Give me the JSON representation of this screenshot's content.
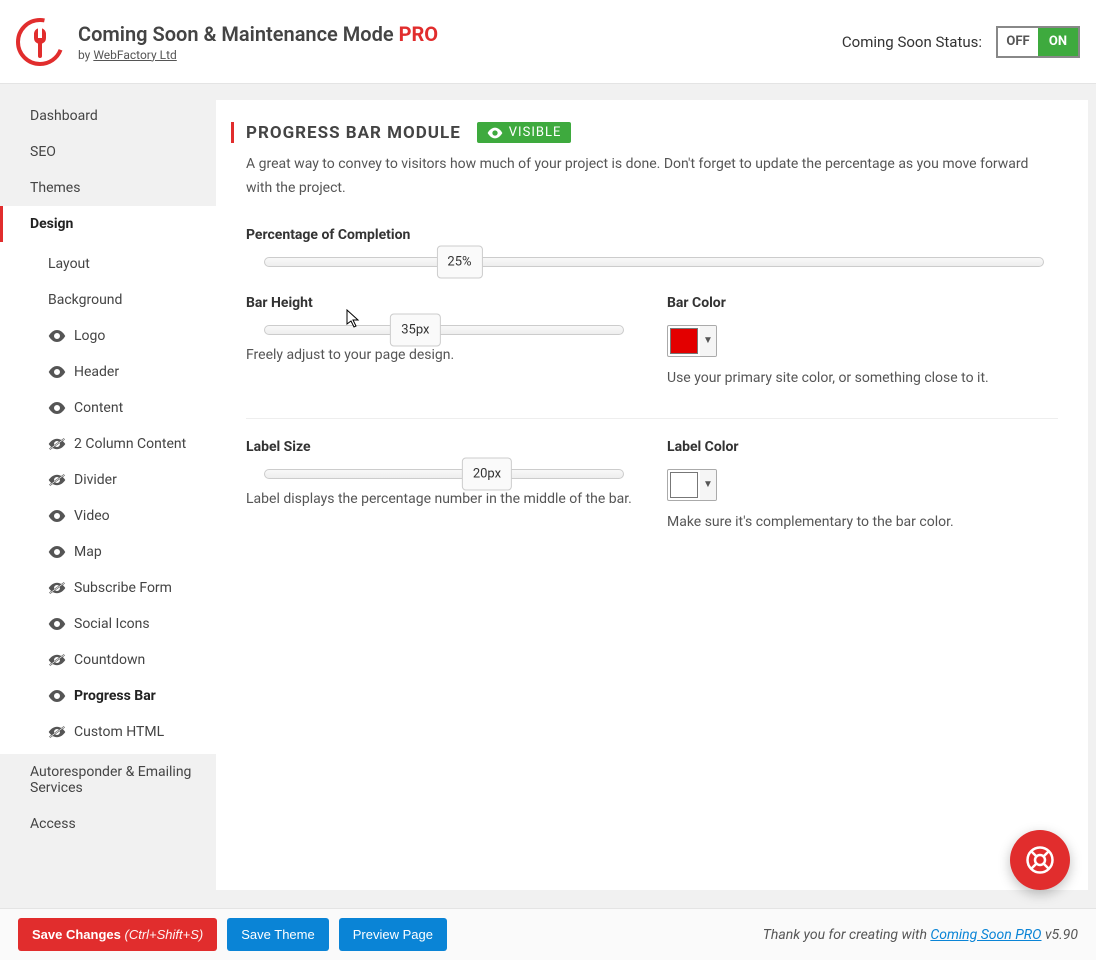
{
  "header": {
    "title_main": "Coming Soon & Maintenance Mode ",
    "title_pro": "PRO",
    "by_prefix": "by ",
    "by_link": "WebFactory Ltd",
    "status_label": "Coming Soon Status:",
    "toggle_off": "OFF",
    "toggle_on": "ON"
  },
  "sidebar": {
    "top": [
      "Dashboard",
      "SEO",
      "Themes",
      "Design"
    ],
    "active_top": "Design",
    "sub": [
      {
        "label": "Layout",
        "icon": "none"
      },
      {
        "label": "Background",
        "icon": "none"
      },
      {
        "label": "Logo",
        "icon": "eye"
      },
      {
        "label": "Header",
        "icon": "eye"
      },
      {
        "label": "Content",
        "icon": "eye"
      },
      {
        "label": "2 Column Content",
        "icon": "eye-off"
      },
      {
        "label": "Divider",
        "icon": "eye-off"
      },
      {
        "label": "Video",
        "icon": "eye"
      },
      {
        "label": "Map",
        "icon": "eye"
      },
      {
        "label": "Subscribe Form",
        "icon": "eye-off"
      },
      {
        "label": "Social Icons",
        "icon": "eye"
      },
      {
        "label": "Countdown",
        "icon": "eye-off"
      },
      {
        "label": "Progress Bar",
        "icon": "eye",
        "active": true
      },
      {
        "label": "Custom HTML",
        "icon": "eye-off"
      }
    ],
    "bottom": [
      "Autoresponder & Emailing Services",
      "Access"
    ]
  },
  "module": {
    "title": "PROGRESS BAR MODULE",
    "badge": "VISIBLE",
    "desc": "A great way to convey to visitors how much of your project is done. Don't forget to update the percentage as you move forward with the project.",
    "percentage": {
      "label": "Percentage of Completion",
      "value": "25%",
      "pos": 25
    },
    "bar_height": {
      "label": "Bar Height",
      "value": "35px",
      "pos": 40,
      "help": "Freely adjust to your page design."
    },
    "bar_color": {
      "label": "Bar Color",
      "value": "#e30000",
      "help": "Use your primary site color, or something close to it."
    },
    "label_size": {
      "label": "Label Size",
      "value": "20px",
      "pos": 62,
      "help": "Label displays the percentage number in the middle of the bar."
    },
    "label_color": {
      "label": "Label Color",
      "value": "#ffffff",
      "help": "Make sure it's complementary to the bar color."
    }
  },
  "footer": {
    "save_changes": "Save Changes",
    "save_hint": "(Ctrl+Shift+S)",
    "save_theme": "Save Theme",
    "preview": "Preview Page",
    "thanks_prefix": "Thank you for creating with ",
    "thanks_link": "Coming Soon PRO",
    "thanks_suffix": " v5.90"
  }
}
